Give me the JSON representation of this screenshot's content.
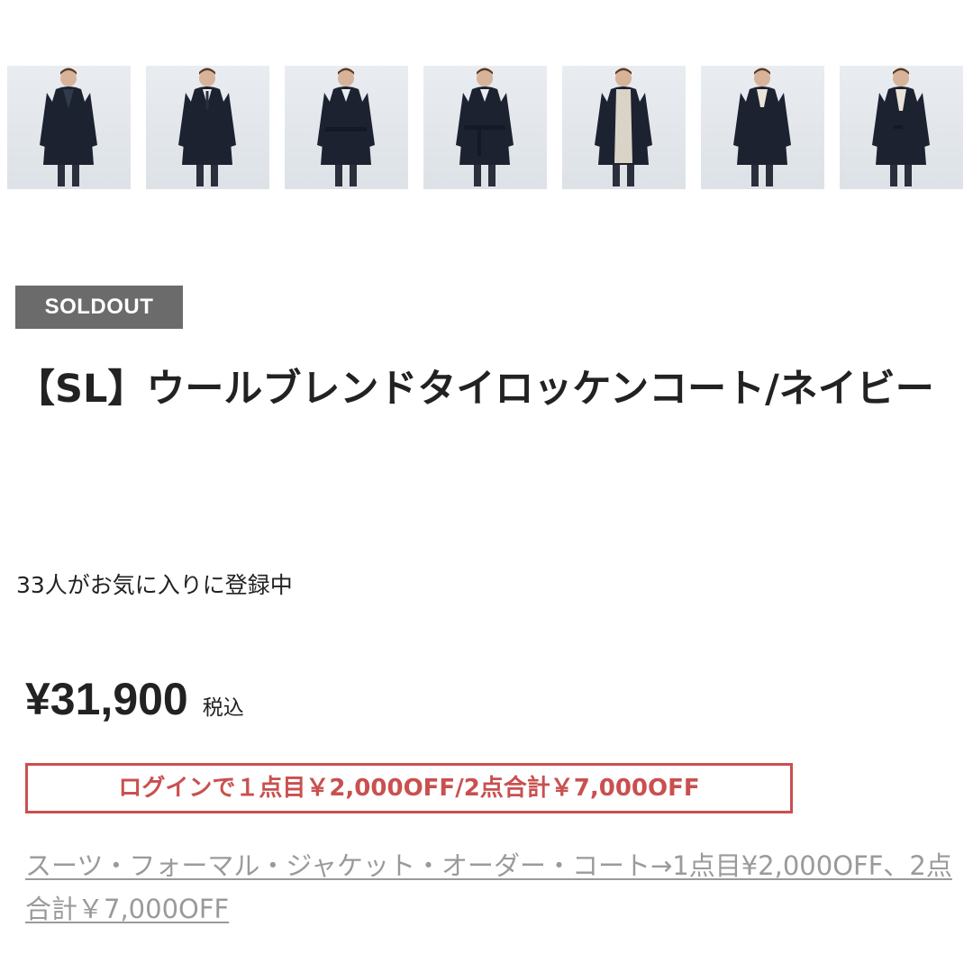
{
  "gallery": {
    "thumbnails": [
      {
        "label": "coat-front-open",
        "style": "open"
      },
      {
        "label": "coat-front-tie",
        "style": "tie"
      },
      {
        "label": "coat-belted",
        "style": "belt"
      },
      {
        "label": "coat-belted-tied",
        "style": "belt"
      },
      {
        "label": "coat-open-knit",
        "style": "knit"
      },
      {
        "label": "coat-closed-knit",
        "style": "knit"
      },
      {
        "label": "coat-open-knit-2",
        "style": "knit"
      }
    ]
  },
  "product": {
    "badge": "SOLDOUT",
    "title": "【SL】ウールブレンドタイロッケンコート/ネイビー",
    "favorites": "33人がお気に入りに登録中",
    "price": "¥31,900",
    "tax_label": "税込",
    "promo": "ログインで１点目￥2,000OFF/2点合計￥7,000OFF",
    "campaign_link": "スーツ・フォーマル・ジャケット・オーダー・コート→1点目¥2,000OFF、2点合計￥7,000OFF"
  },
  "colors": {
    "badge_bg": "#6b6b6b",
    "promo_red": "#c9504f",
    "link_gray": "#9a9a9a",
    "coat_navy": "#1c2230"
  }
}
